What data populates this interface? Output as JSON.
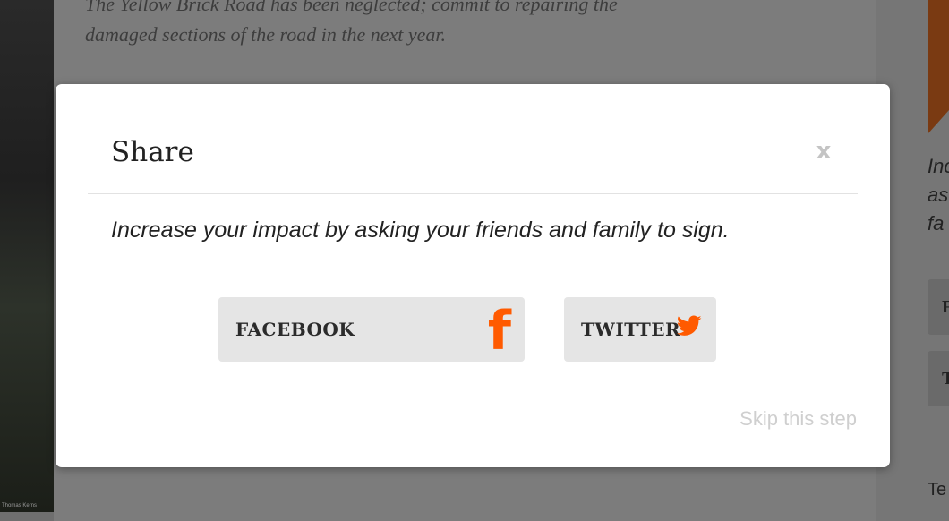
{
  "background": {
    "quote_line1": "The Yellow Brick Road has been neglected; commit to repairing the",
    "quote_line2": "damaged sections of the road in the next year.",
    "photo_credit": "Thomas Kerns",
    "right_text_line1": "Inc",
    "right_text_line2": "as",
    "right_text_line3": "fa",
    "right_button1": "F",
    "right_button2": "T",
    "right_bottom": "Te"
  },
  "modal": {
    "title": "Share",
    "close_label": "x",
    "message": "Increase your impact by asking your friends and family to sign.",
    "facebook_label": "FACEBOOK",
    "facebook_icon": "facebook-icon",
    "twitter_label": "TWITTER",
    "twitter_icon": "twitter-bird-icon",
    "skip_label": "Skip this step"
  },
  "colors": {
    "accent": "#ff5a00",
    "button_bg": "#e5e5e5",
    "overlay": "#6f6f6f"
  }
}
